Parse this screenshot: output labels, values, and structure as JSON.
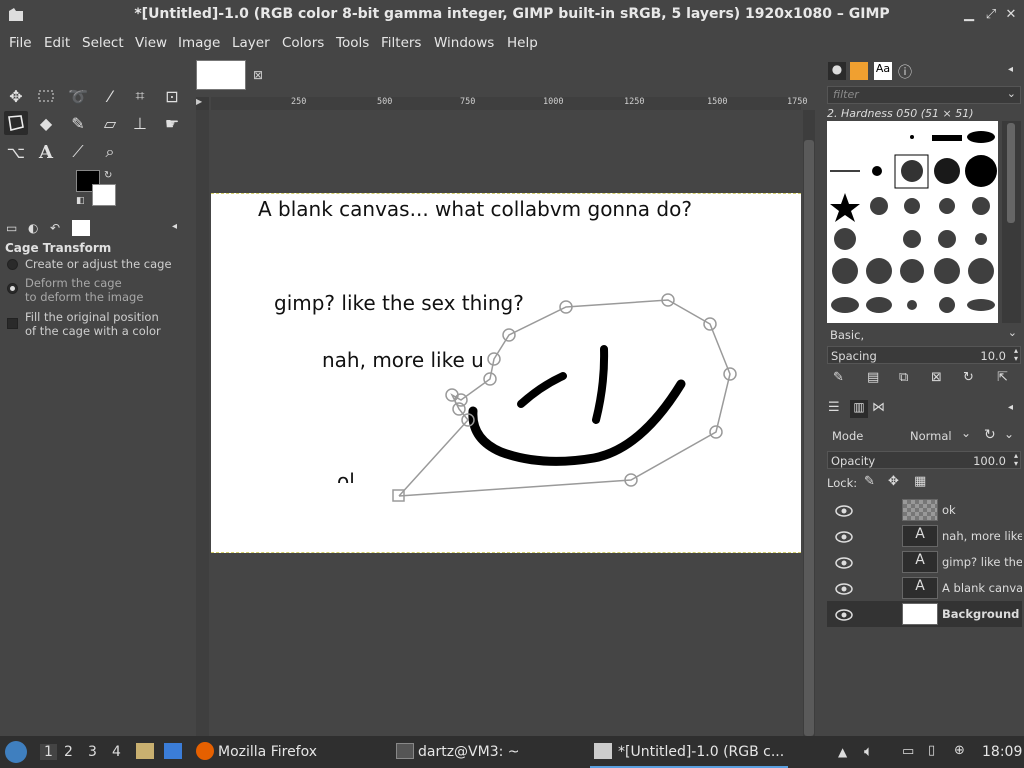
{
  "window": {
    "title": "*[Untitled]-1.0 (RGB color 8-bit gamma integer, GIMP built-in sRGB, 5 layers) 1920x1080 – GIMP"
  },
  "menu": [
    "File",
    "Edit",
    "Select",
    "View",
    "Image",
    "Layer",
    "Colors",
    "Tools",
    "Filters",
    "Windows",
    "Help"
  ],
  "tool_options": {
    "title": "Cage Transform",
    "option1": "Create or adjust the cage",
    "option2_line1": "Deform the cage",
    "option2_line2": "to deform the image",
    "option3_line1": "Fill the original position",
    "option3_line2": "of the cage with a color"
  },
  "ruler": {
    "h_labels": [
      "250",
      "500",
      "750",
      "1000",
      "1250",
      "1500",
      "1750"
    ]
  },
  "canvas": {
    "line1": "A blank canvas... what collabvm gonna do?",
    "line2": "gimp? like the sex thing?",
    "line3": "nah, more like u",
    "line4": "ol"
  },
  "brushes": {
    "filter_placeholder": "filter",
    "selected": "2. Hardness 050 (51 × 51)",
    "tag": "Basic,",
    "spacing_label": "Spacing",
    "spacing_value": "10.0"
  },
  "layers": {
    "mode_label": "Mode",
    "mode_value": "Normal",
    "opacity_label": "Opacity",
    "opacity_value": "100.0",
    "lock_label": "Lock:",
    "items": [
      {
        "name": "ok",
        "type": "raster"
      },
      {
        "name": "nah, more like u",
        "type": "text"
      },
      {
        "name": "gimp? like the sex thing?",
        "type": "text"
      },
      {
        "name": "A blank canvas",
        "type": "text"
      },
      {
        "name": "Background",
        "type": "raster",
        "selected": true
      }
    ]
  },
  "taskbar": {
    "workspaces": [
      "1",
      "2",
      "3",
      "4"
    ],
    "app1": "Mozilla Firefox",
    "app2": "dartz@VM3: ~",
    "app3": "*[Untitled]-1.0 (RGB c...",
    "clock": "18:09"
  }
}
